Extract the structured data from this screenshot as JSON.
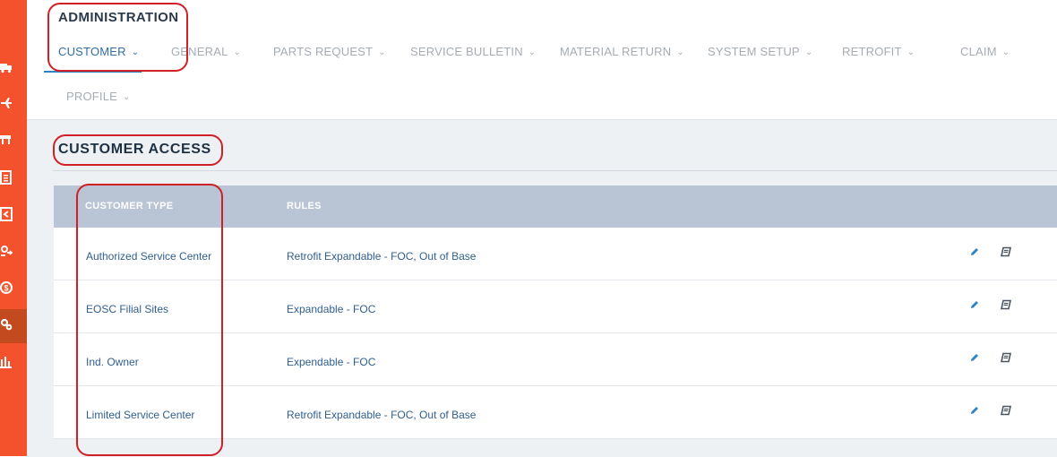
{
  "sidebar": {
    "items": [
      {
        "icon": "truck-icon"
      },
      {
        "icon": "plane-icon"
      },
      {
        "icon": "cart-icon"
      },
      {
        "icon": "document-icon"
      },
      {
        "icon": "return-icon"
      },
      {
        "icon": "retrofit-icon"
      },
      {
        "icon": "dollar-icon"
      },
      {
        "icon": "gears-icon",
        "active": true
      },
      {
        "icon": "bar-chart-icon"
      }
    ]
  },
  "header": {
    "title": "ADMINISTRATION",
    "nav": [
      {
        "label": "CUSTOMER",
        "active": true
      },
      {
        "label": "GENERAL"
      },
      {
        "label": "PARTS REQUEST"
      },
      {
        "label": "SERVICE BULLETIN"
      },
      {
        "label": "MATERIAL RETURN"
      },
      {
        "label": "SYSTEM SETUP"
      },
      {
        "label": "RETROFIT"
      },
      {
        "label": "CLAIM"
      },
      {
        "label": "PROFILE"
      }
    ],
    "chevron": "⌄"
  },
  "section": {
    "title": "CUSTOMER ACCESS"
  },
  "table": {
    "columns": [
      "CUSTOMER TYPE",
      "RULES"
    ],
    "rows": [
      {
        "type": "Authorized Service Center",
        "rules": "Retrofit Expandable - FOC, Out of Base"
      },
      {
        "type": "EOSC Filial Sites",
        "rules": "Expandable - FOC"
      },
      {
        "type": "Ind. Owner",
        "rules": "Expendable - FOC"
      },
      {
        "type": "Limited Service Center",
        "rules": "Retrofit Expandable - FOC, Out of Base"
      }
    ]
  },
  "colors": {
    "sidebar": "#f4522d",
    "sidebar_active": "#c34a1f",
    "accent": "#2f82c5",
    "table_header": "#b9c5d4",
    "callout": "#d11f26"
  }
}
